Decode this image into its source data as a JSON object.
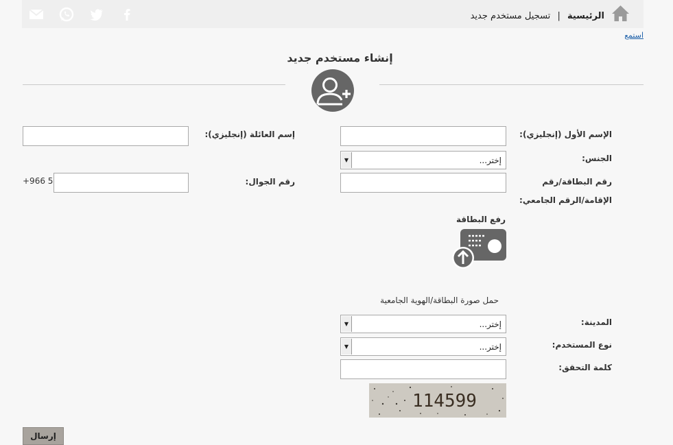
{
  "breadcrumb": {
    "home": "الرئيسية",
    "separator": "|",
    "current": "تسجيل مستخدم جديد"
  },
  "listen_link": "استمع",
  "page_title": "إنشاء مستخدم جديد",
  "form": {
    "first_name_label": "الإسم الأول (إنجليزي):",
    "family_name_label": "إسم العائلة (إنجليزي):",
    "gender_label": "الجنس:",
    "gender_value": "إختر...",
    "id_label_line1": "رقم البطاقة/رقم",
    "id_label_line2": "الإقامة/الرقم الجامعي:",
    "mobile_label": "رقم الجوال:",
    "mobile_prefix": "+966 5",
    "upload_label": "رفع البطاقة",
    "upload_hint": "حمل صورة البطاقة/الهوية الجامعية",
    "city_label": "المدينة:",
    "city_value": "إختر...",
    "user_type_label": "نوع المستخدم:",
    "user_type_value": "إختر...",
    "captcha_label": "كلمة التحقق:",
    "captcha_text": "114599",
    "submit_label": "إرسال"
  },
  "colors": {
    "icon_gray": "#666666",
    "link": "#1a5ea8",
    "button": "#a8a39d"
  }
}
